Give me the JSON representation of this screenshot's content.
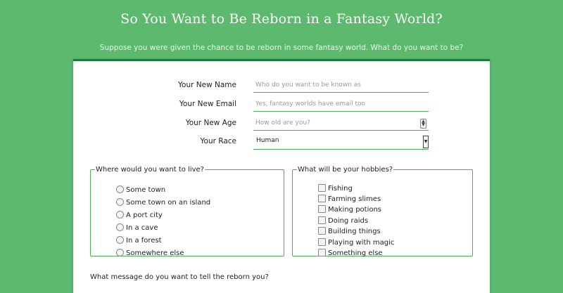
{
  "page": {
    "title": "So You Want to Be Reborn in a Fantasy World?",
    "subtitle": "Suppose you were given the chance to be reborn in some fantasy world. What do you want to be?"
  },
  "form": {
    "name": {
      "label": "Your New Name",
      "placeholder": "Who do you want to be known as"
    },
    "email": {
      "label": "Your New Email",
      "placeholder": "Yes, fantasy worlds have email too"
    },
    "age": {
      "label": "Your New Age",
      "placeholder": "How old are you?"
    },
    "race": {
      "label": "Your Race",
      "selected": "Human"
    }
  },
  "live": {
    "legend": "Where would you want to live?",
    "options": [
      "Some town",
      "Some town on an island",
      "A port city",
      "In a cave",
      "In a forest",
      "Somewhere else"
    ]
  },
  "hobbies": {
    "legend": "What will be your hobbies?",
    "options": [
      "Fishing",
      "Farming slimes",
      "Making potions",
      "Doing raids",
      "Building things",
      "Playing with magic",
      "Something else"
    ]
  },
  "message": {
    "label": "What message do you want to tell the reborn you?"
  },
  "colors": {
    "background": "#5cb96e",
    "accent": "#4caf50",
    "card_top_border": "#1f7a3a"
  }
}
